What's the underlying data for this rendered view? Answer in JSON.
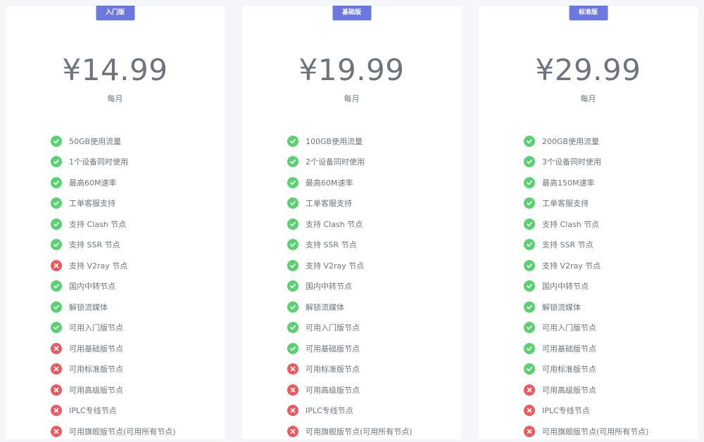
{
  "plans": [
    {
      "badge": "入门版",
      "price": "¥14.99",
      "period": "每月",
      "features": [
        {
          "label": "50GB使用流量",
          "status": "ok"
        },
        {
          "label": "1个设备同时使用",
          "status": "ok"
        },
        {
          "label": "最高60M速率",
          "status": "ok"
        },
        {
          "label": "工单客服支持",
          "status": "ok"
        },
        {
          "label": "支持 Clash 节点",
          "status": "ok"
        },
        {
          "label": "支持 SSR 节点",
          "status": "ok"
        },
        {
          "label": "支持 V2ray 节点",
          "status": "no"
        },
        {
          "label": "国内中转节点",
          "status": "ok"
        },
        {
          "label": "解锁流媒体",
          "status": "ok"
        },
        {
          "label": "可用入门版节点",
          "status": "ok"
        },
        {
          "label": "可用基础版节点",
          "status": "no"
        },
        {
          "label": "可用标准版节点",
          "status": "no"
        },
        {
          "label": "可用高级版节点",
          "status": "no"
        },
        {
          "label": "IPLC专线节点",
          "status": "no"
        },
        {
          "label": "可用旗舰版节点(可用所有节点)",
          "status": "no"
        }
      ]
    },
    {
      "badge": "基础版",
      "price": "¥19.99",
      "period": "每月",
      "features": [
        {
          "label": "100GB使用流量",
          "status": "ok"
        },
        {
          "label": "2个设备同时使用",
          "status": "ok"
        },
        {
          "label": "最高60M速率",
          "status": "ok"
        },
        {
          "label": "工单客服支持",
          "status": "ok"
        },
        {
          "label": "支持 Clash 节点",
          "status": "ok"
        },
        {
          "label": "支持 SSR 节点",
          "status": "ok"
        },
        {
          "label": "支持 V2ray 节点",
          "status": "ok"
        },
        {
          "label": "国内中转节点",
          "status": "ok"
        },
        {
          "label": "解锁流媒体",
          "status": "ok"
        },
        {
          "label": "可用入门版节点",
          "status": "ok"
        },
        {
          "label": "可用基础版节点",
          "status": "ok"
        },
        {
          "label": "可用标准版节点",
          "status": "no"
        },
        {
          "label": "可用高级版节点",
          "status": "no"
        },
        {
          "label": "IPLC专线节点",
          "status": "no"
        },
        {
          "label": "可用旗舰版节点(可用所有节点)",
          "status": "no"
        }
      ]
    },
    {
      "badge": "标准版",
      "price": "¥29.99",
      "period": "每月",
      "features": [
        {
          "label": "200GB使用流量",
          "status": "ok"
        },
        {
          "label": "3个设备同时使用",
          "status": "ok"
        },
        {
          "label": "最高150M速率",
          "status": "ok"
        },
        {
          "label": "工单客服支持",
          "status": "ok"
        },
        {
          "label": "支持 Clash 节点",
          "status": "ok"
        },
        {
          "label": "支持 SSR 节点",
          "status": "ok"
        },
        {
          "label": "支持 V2ray 节点",
          "status": "ok"
        },
        {
          "label": "国内中转节点",
          "status": "ok"
        },
        {
          "label": "解锁流媒体",
          "status": "ok"
        },
        {
          "label": "可用入门版节点",
          "status": "ok"
        },
        {
          "label": "可用基础版节点",
          "status": "ok"
        },
        {
          "label": "可用标准版节点",
          "status": "ok"
        },
        {
          "label": "可用高级版节点",
          "status": "no"
        },
        {
          "label": "IPLC专线节点",
          "status": "no"
        },
        {
          "label": "可用旗舰版节点(可用所有节点)",
          "status": "no"
        }
      ]
    }
  ],
  "colors": {
    "badge": "#6b78e0",
    "check": "#58d16f",
    "cross": "#f0565d",
    "text": "#6c757d"
  },
  "icons": {
    "ok": "check-circle-icon",
    "no": "cross-circle-icon"
  }
}
